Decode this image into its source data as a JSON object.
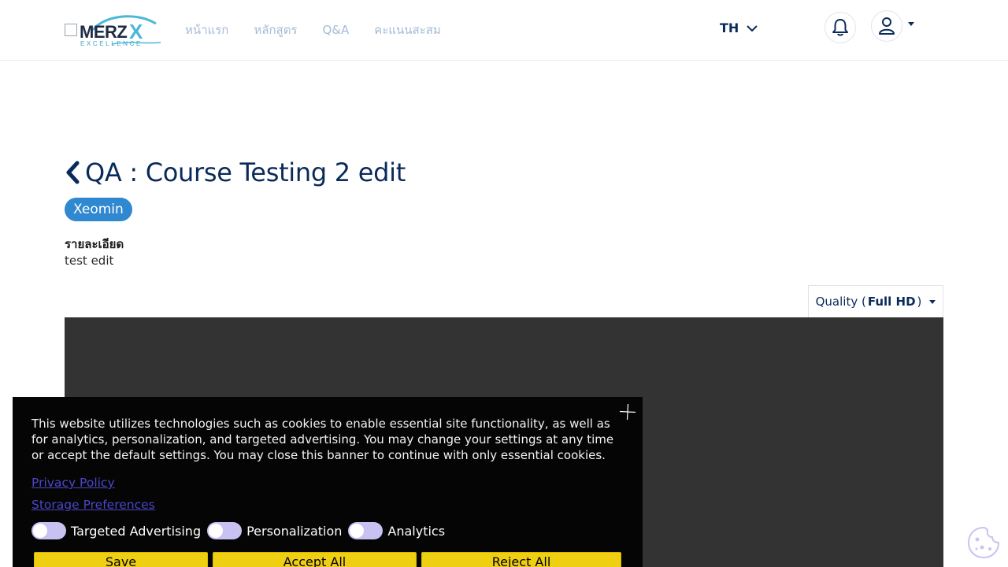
{
  "header": {
    "logo": {
      "wordmark": "MERZ",
      "mark": "X",
      "tagline": "EXCELLENCE"
    },
    "nav": [
      {
        "label": "หน้าแรก"
      },
      {
        "label": "หลักสูตร"
      },
      {
        "label": "Q&A"
      },
      {
        "label": "คะแนนสะสม"
      }
    ],
    "language": "TH",
    "icons": {
      "notifications": "bell-icon",
      "account": "user-icon"
    }
  },
  "main": {
    "title": "QA : Course Testing 2 edit",
    "badge": "Xeomin",
    "detail_label": "รายละเอียด",
    "detail_text": "test edit",
    "quality": {
      "prefix": "Quality (",
      "value": "Full HD",
      "suffix": ")"
    }
  },
  "cookie_banner": {
    "message": "This website utilizes technologies such as cookies to enable essential site functionality, as well as for analytics, personalization, and targeted advertising. You may change your settings at any time or accept the default settings. You may close this banner to continue with only essential cookies.",
    "privacy_link": "Privacy Policy",
    "storage_link": "Storage Preferences",
    "toggles": [
      {
        "label": "Targeted Advertising",
        "on": false
      },
      {
        "label": "Personalization",
        "on": false
      },
      {
        "label": "Analytics",
        "on": false
      }
    ],
    "buttons": {
      "save": "Save",
      "accept": "Accept All",
      "reject": "Reject All"
    }
  },
  "colors": {
    "primary": "#0a2a5a",
    "nav_link": "#a5bbd6",
    "badge": "#2f88d0",
    "video_bg": "#333333",
    "cookie_bg": "#050505",
    "cookie_button": "#efcf12",
    "cookie_link": "#4b46c9",
    "toggle_track": "#c7c2f2"
  }
}
